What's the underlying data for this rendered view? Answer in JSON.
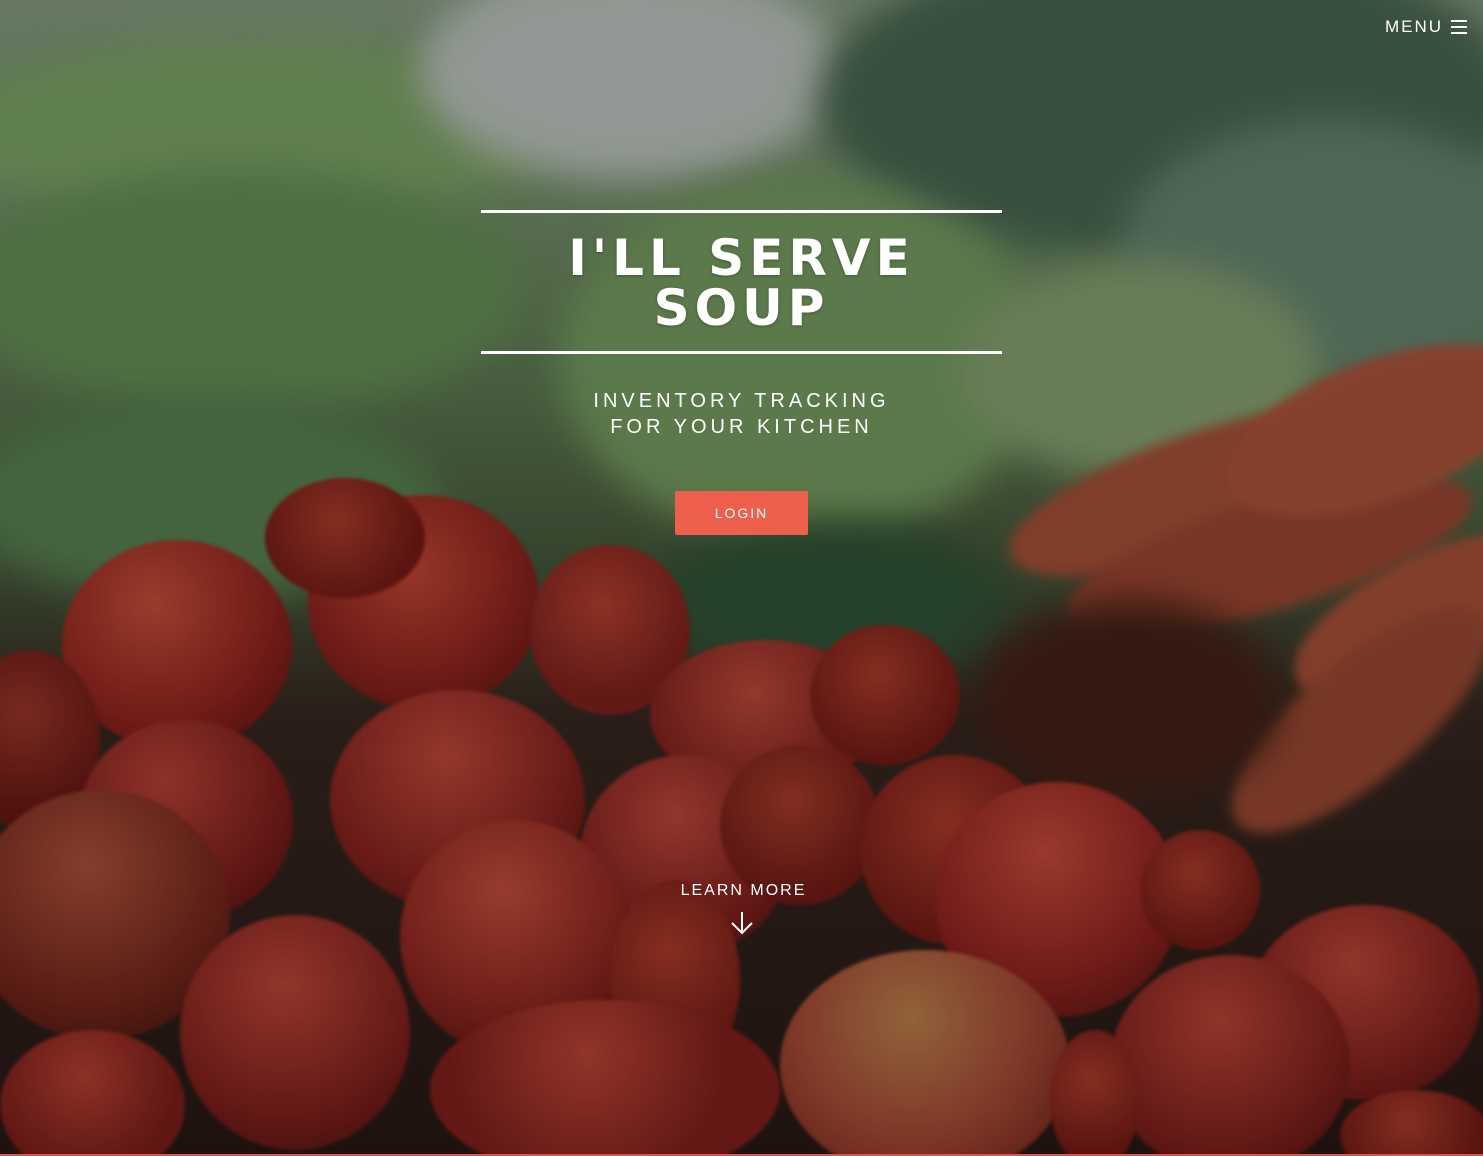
{
  "nav": {
    "menu_label": "MENU",
    "menu_icon": "hamburger-icon"
  },
  "hero": {
    "title": "I'LL SERVE SOUP",
    "subtitle_line1": "INVENTORY TRACKING",
    "subtitle_line2": "FOR YOUR KITCHEN",
    "login_label": "LOGIN"
  },
  "footer_cta": {
    "learn_more_label": "LEARN MORE",
    "arrow_icon": "arrow-down-icon"
  },
  "colors": {
    "accent": "#ef5f4e",
    "text": "#ffffff"
  }
}
